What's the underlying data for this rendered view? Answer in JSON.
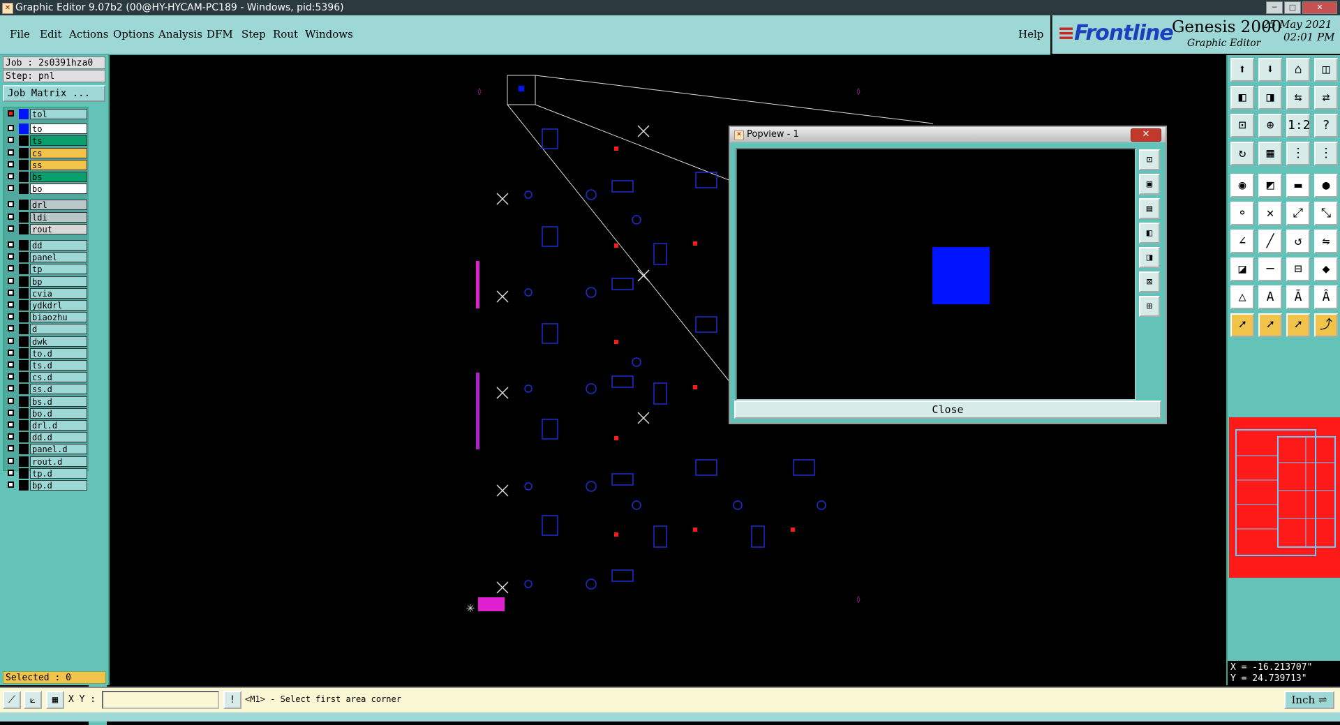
{
  "window": {
    "title": "Graphic Editor 9.07b2 (00@HY-HYCAM-PC189 - Windows, pid:5396)",
    "icon": "x-app-icon",
    "controls": [
      "minimize",
      "maximize",
      "close"
    ]
  },
  "menubar": {
    "items": [
      {
        "label": "File"
      },
      {
        "label": "Edit"
      },
      {
        "label": "Actions"
      },
      {
        "label": "Options"
      },
      {
        "label": "Analysis"
      },
      {
        "label": "DFM"
      },
      {
        "label": "Step"
      },
      {
        "label": "Rout"
      },
      {
        "label": "Windows"
      }
    ],
    "help": "Help"
  },
  "brand": {
    "logo": "Frontline",
    "product": "Genesis 2000",
    "subtitle": "Graphic Editor",
    "date": "25 May 2021",
    "time": "02:01 PM"
  },
  "job": {
    "job_label": "Job : 2s0391hza0",
    "step_label": "Step: pnl",
    "matrix_button": "Job Matrix ..."
  },
  "layers": [
    {
      "name": "tol",
      "swatch": "#ff0000",
      "bg": "#9ed8d6",
      "work": true
    },
    {
      "name": "to",
      "swatch": "#0014ff",
      "bg": "#ffffff"
    },
    {
      "name": "ts",
      "swatch": "#000000",
      "bg": "#0aa06e"
    },
    {
      "name": "cs",
      "swatch": "#000000",
      "bg": "#f2c34a"
    },
    {
      "name": "ss",
      "swatch": "#000000",
      "bg": "#f2c34a"
    },
    {
      "name": "bs",
      "swatch": "#000000",
      "bg": "#0aa06e"
    },
    {
      "name": "bo",
      "swatch": "#000000",
      "bg": "#ffffff"
    },
    {
      "name": "drl",
      "swatch": "#000000",
      "bg": "#b9c7c8"
    },
    {
      "name": "ldi",
      "swatch": "#000000",
      "bg": "#b9c7c8"
    },
    {
      "name": "rout",
      "swatch": "#000000",
      "bg": "#d8d8d8"
    },
    {
      "name": "dd",
      "swatch": "#000000",
      "bg": "#9ed8d6"
    },
    {
      "name": "panel",
      "swatch": "#000000",
      "bg": "#9ed8d6"
    },
    {
      "name": "tp",
      "swatch": "#000000",
      "bg": "#9ed8d6"
    },
    {
      "name": "bp",
      "swatch": "#000000",
      "bg": "#9ed8d6"
    },
    {
      "name": "cvia",
      "swatch": "#000000",
      "bg": "#9ed8d6"
    },
    {
      "name": "ydkdrl",
      "swatch": "#000000",
      "bg": "#9ed8d6"
    },
    {
      "name": "biaozhu",
      "swatch": "#000000",
      "bg": "#9ed8d6"
    },
    {
      "name": "d",
      "swatch": "#000000",
      "bg": "#9ed8d6"
    },
    {
      "name": "dwk",
      "swatch": "#000000",
      "bg": "#9ed8d6"
    },
    {
      "name": "to.d",
      "swatch": "#000000",
      "bg": "#9ed8d6"
    },
    {
      "name": "ts.d",
      "swatch": "#000000",
      "bg": "#9ed8d6"
    },
    {
      "name": "cs.d",
      "swatch": "#000000",
      "bg": "#9ed8d6"
    },
    {
      "name": "ss.d",
      "swatch": "#000000",
      "bg": "#9ed8d6"
    },
    {
      "name": "bs.d",
      "swatch": "#000000",
      "bg": "#9ed8d6"
    },
    {
      "name": "bo.d",
      "swatch": "#000000",
      "bg": "#9ed8d6"
    },
    {
      "name": "drl.d",
      "swatch": "#000000",
      "bg": "#9ed8d6"
    },
    {
      "name": "dd.d",
      "swatch": "#000000",
      "bg": "#9ed8d6"
    },
    {
      "name": "panel.d",
      "swatch": "#000000",
      "bg": "#9ed8d6"
    },
    {
      "name": "rout.d",
      "swatch": "#000000",
      "bg": "#9ed8d6"
    },
    {
      "name": "tp.d",
      "swatch": "#000000",
      "bg": "#9ed8d6"
    },
    {
      "name": "bp.d",
      "swatch": "#000000",
      "bg": "#9ed8d6"
    }
  ],
  "selected": "Selected : 0",
  "popview": {
    "title": "Popview - 1",
    "close_x": "✕",
    "close_button": "Close",
    "side_icons": [
      "zoom-fit-icon",
      "zoom-home-icon",
      "pan-up-icon",
      "pan-left-icon",
      "pan-right-icon",
      "zoom-in-icon",
      "zoom-out-icon"
    ]
  },
  "coords": {
    "x": "X = -16.213707\"",
    "y": "Y = 24.739713\""
  },
  "bottombar": {
    "xy_label": "X Y :",
    "xy_value": "",
    "prompt": "<M1> - Select first area corner",
    "unit": "Inch"
  },
  "colors": {
    "panel": "#63c3b9",
    "menubar": "#9ed8d6",
    "layer_to": "#0014ff",
    "highlight": "#ff1a1a",
    "magenta": "#e020d0"
  },
  "toolbox_icons": [
    "zoom-home-icon",
    "zoom-up-icon",
    "home-icon",
    "window-split-icon",
    "pan-left-icon",
    "pan-right-icon",
    "mirror-icon",
    "swap-icon",
    "zoom-fit-icon",
    "zoom-center-icon",
    "scale-icon",
    "question-icon",
    "rotate-icon",
    "grid-icon",
    "snap-icon",
    "snap-alt-icon",
    "camera-icon",
    "measure-icon",
    "ruler-icon",
    "pad-icon",
    "node-icon",
    "cross-icon",
    "connect-icon",
    "connect-alt-icon",
    "line-icon",
    "line-alt-icon",
    "rotate-arc-icon",
    "flip-icon",
    "shape-icon",
    "minus-icon",
    "bracket-icon",
    "shapes-icon",
    "triangle-icon",
    "a-text-icon",
    "a-bar-icon",
    "a-box-icon",
    "select-arrow-icon",
    "select-box-icon",
    "select-plus-icon",
    "select-path-icon"
  ]
}
